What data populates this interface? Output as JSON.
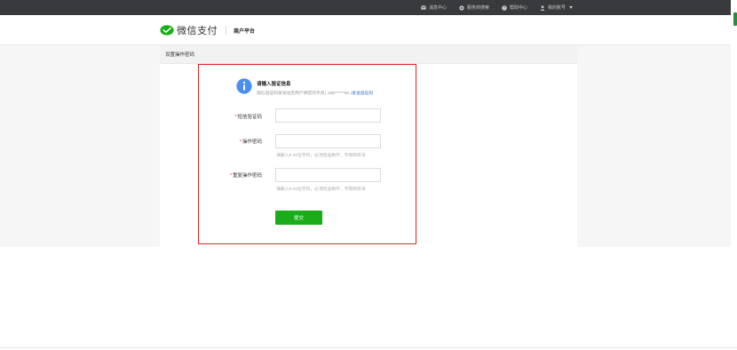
{
  "topbar": {
    "items": [
      {
        "label": "消息中心",
        "icon": "mail-icon"
      },
      {
        "label": "服务商搜索",
        "icon": "gear-icon"
      },
      {
        "label": "帮助中心",
        "icon": "help-icon"
      },
      {
        "label": "我的账号",
        "icon": "user-icon"
      }
    ]
  },
  "header": {
    "logo_text": "微信支付",
    "platform_name": "商户平台"
  },
  "breadcrumb": "设置操作密码",
  "notice": {
    "title": "请输入验证信息",
    "desc_prefix": "短信验证码将发送至商户绑定的手机( 188******60 )",
    "resend_link": "发送验证码"
  },
  "form": {
    "sms_code_label": "短信验证码",
    "sms_code_value": "",
    "password_label": "操作密码",
    "password_value": "",
    "password_hint": "请输入8-20位字符，必须包含数字、字母和符号",
    "confirm_label": "重复操作密码",
    "confirm_value": "",
    "confirm_hint": "请输入8-20位字符，必须包含数字、字母和符号",
    "required_mark": "*",
    "submit_label": "提交"
  },
  "colors": {
    "topbar": "#393a3e",
    "brand_green": "#1aad19",
    "highlight_red": "#e02020",
    "info_blue": "#4a8ef0",
    "link_blue": "#3a73c8"
  }
}
